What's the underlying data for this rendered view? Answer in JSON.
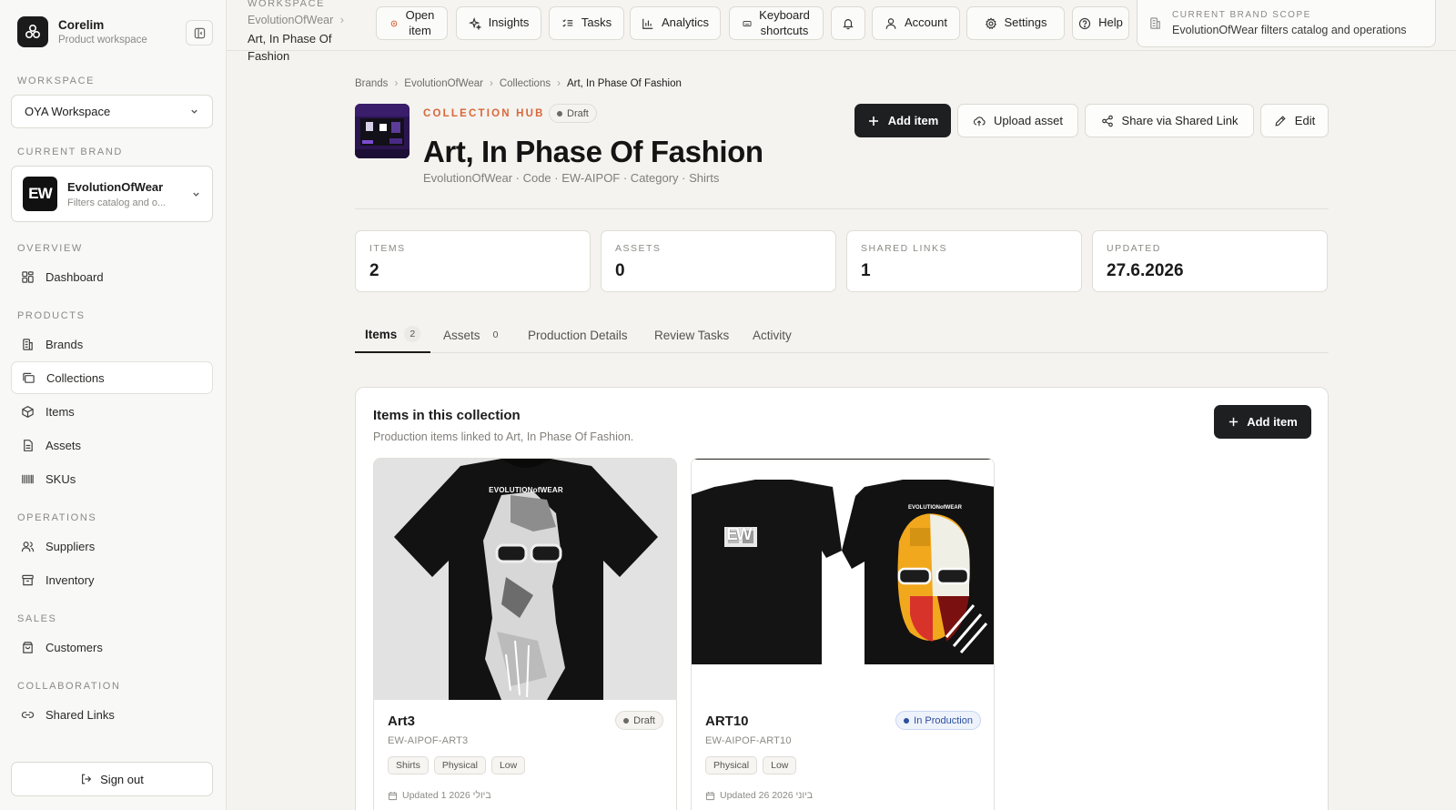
{
  "sidebar": {
    "app_name": "Corelim",
    "app_sub": "Product workspace",
    "workspace_label": "WORKSPACE",
    "workspace_value": "OYA Workspace",
    "brand_label": "CURRENT BRAND",
    "brand_name": "EvolutionOfWear",
    "brand_desc": "Filters catalog and o...",
    "brand_logo_text": "EW",
    "sections": {
      "overview": "OVERVIEW",
      "products": "PRODUCTS",
      "operations": "OPERATIONS",
      "sales": "SALES",
      "collaboration": "COLLABORATION"
    },
    "items": {
      "dashboard": "Dashboard",
      "brands": "Brands",
      "collections": "Collections",
      "items": "Items",
      "assets": "Assets",
      "skus": "SKUs",
      "suppliers": "Suppliers",
      "inventory": "Inventory",
      "customers": "Customers",
      "shared_links": "Shared Links"
    },
    "sign_out": "Sign out"
  },
  "topbar": {
    "crumb_label": "WORKSPACE",
    "crumb_brand": "EvolutionOfWear",
    "crumb_current_1": "Art, In Phase Of",
    "crumb_current_2": "Fashion",
    "open_item_1": "Open",
    "open_item_2": "item",
    "insights": "Insights",
    "tasks": "Tasks",
    "analytics": "Analytics",
    "keyboard_1": "Keyboard",
    "keyboard_2": "shortcuts",
    "account": "Account",
    "settings": "Settings",
    "help": "Help",
    "scope_label": "CURRENT BRAND SCOPE",
    "scope_value": "EvolutionOfWear filters catalog and operations"
  },
  "breadcrumb": [
    "Brands",
    "EvolutionOfWear",
    "Collections",
    "Art, In Phase Of Fashion"
  ],
  "hero": {
    "hub_label": "COLLECTION HUB",
    "status": "Draft",
    "title": "Art, In Phase Of Fashion",
    "meta": "EvolutionOfWear · Code · EW-AIPOF · Category · Shirts"
  },
  "actions": {
    "add_item": "Add item",
    "upload_asset": "Upload asset",
    "share": "Share via Shared Link",
    "edit": "Edit"
  },
  "stats": [
    {
      "label": "ITEMS",
      "value": "2"
    },
    {
      "label": "ASSETS",
      "value": "0"
    },
    {
      "label": "SHARED LINKS",
      "value": "1"
    },
    {
      "label": "UPDATED",
      "value": "27.6.2026"
    }
  ],
  "tabs": [
    {
      "label": "Items",
      "count": "2"
    },
    {
      "label": "Assets",
      "count": "0"
    },
    {
      "label": "Production Details"
    },
    {
      "label": "Review Tasks"
    },
    {
      "label": "Activity"
    }
  ],
  "panel": {
    "title": "Items in this collection",
    "subtitle": "Production items linked to Art, In Phase Of Fashion.",
    "add_item": "Add item"
  },
  "cards": [
    {
      "name": "Art3",
      "code": "EW-AIPOF-ART3",
      "status": "Draft",
      "tags": [
        "Shirts",
        "Physical",
        "Low"
      ],
      "updated": "Updated 1 2026 ביולי",
      "shirt_print": "EVOLUTIONofWEAR"
    },
    {
      "name": "ART10",
      "code": "EW-AIPOF-ART10",
      "status": "In Production",
      "tags": [
        "Physical",
        "Low"
      ],
      "updated": "Updated 26 2026 ביוני",
      "shirt_print": "EVOLUTIONofWEAR",
      "shirt_logo": "EW"
    }
  ]
}
